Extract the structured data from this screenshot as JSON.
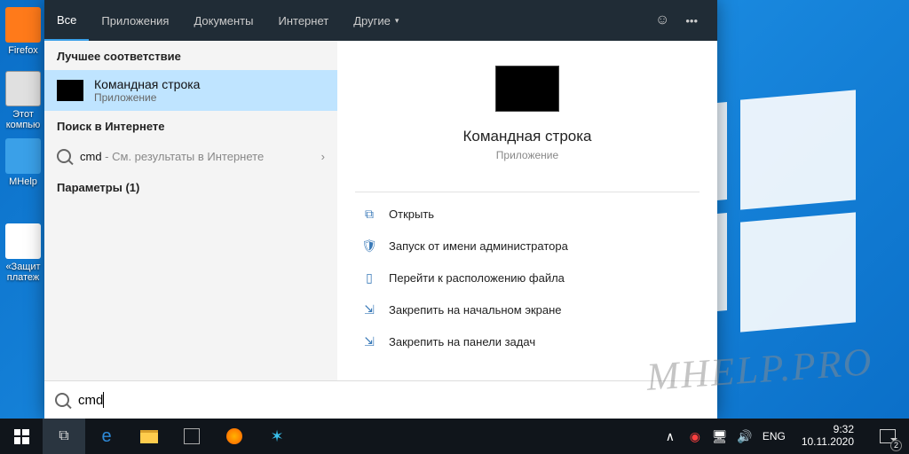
{
  "desktop_icons": [
    "Firefox",
    "Этот компью",
    "MHelp",
    "«Защит платеж"
  ],
  "tabs": {
    "all": "Все",
    "apps": "Приложения",
    "docs": "Документы",
    "internet": "Интернет",
    "more": "Другие"
  },
  "header_icons": {
    "feedback": "feedback-icon",
    "more": "•••"
  },
  "left": {
    "best_title": "Лучшее соответствие",
    "best_name": "Командная строка",
    "best_sub": "Приложение",
    "web_title": "Поиск в Интернете",
    "web_query": "cmd",
    "web_hint": " - См. результаты в Интернете",
    "params": "Параметры (1)"
  },
  "preview": {
    "title": "Командная строка",
    "subtitle": "Приложение"
  },
  "actions": {
    "open": "Открыть",
    "admin": "Запуск от имени администратора",
    "loc": "Перейти к расположению файла",
    "pin_start": "Закрепить на начальном экране",
    "pin_task": "Закрепить на панели задач"
  },
  "search": {
    "placeholder": "",
    "value": "cmd"
  },
  "tray": {
    "lang": "ENG",
    "time": "9:32",
    "date": "10.11.2020",
    "notif_count": "2",
    "chevron": "∧"
  },
  "watermark": "MHELP.PRO"
}
